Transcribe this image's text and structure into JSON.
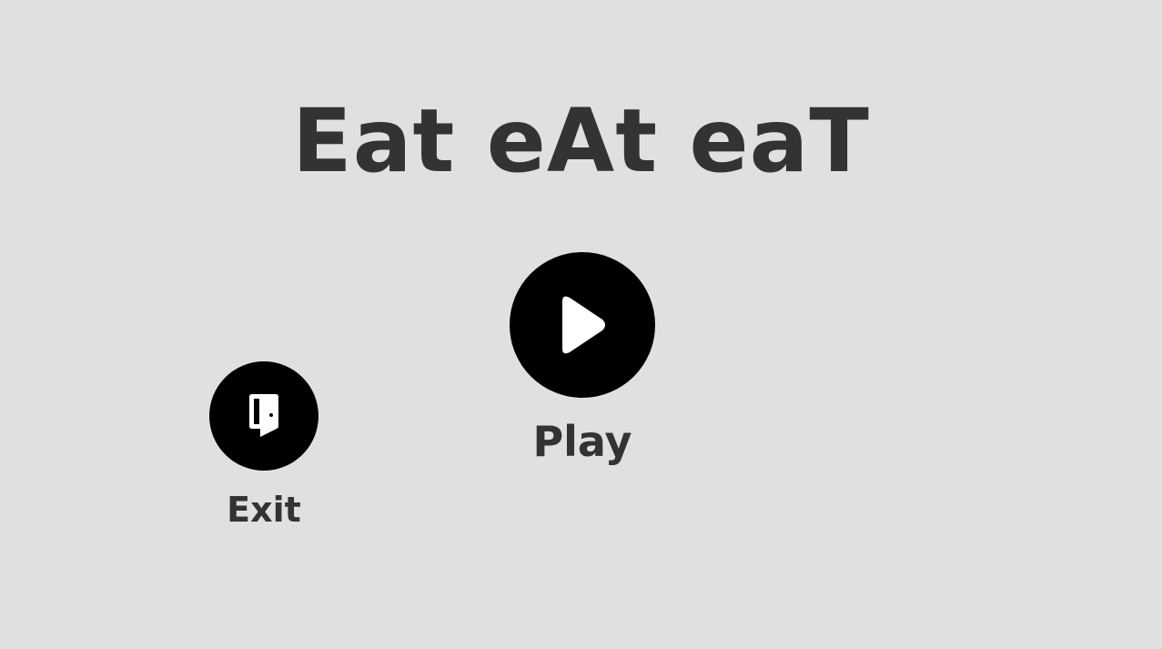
{
  "title": "Eat eAt eaT",
  "buttons": {
    "play": {
      "label": "Play",
      "icon": "play-icon"
    },
    "exit": {
      "label": "Exit",
      "icon": "door-exit-icon"
    }
  },
  "colors": {
    "background": "#e0e0e0",
    "text": "#333333",
    "button_fill": "#000000",
    "icon": "#ffffff"
  }
}
